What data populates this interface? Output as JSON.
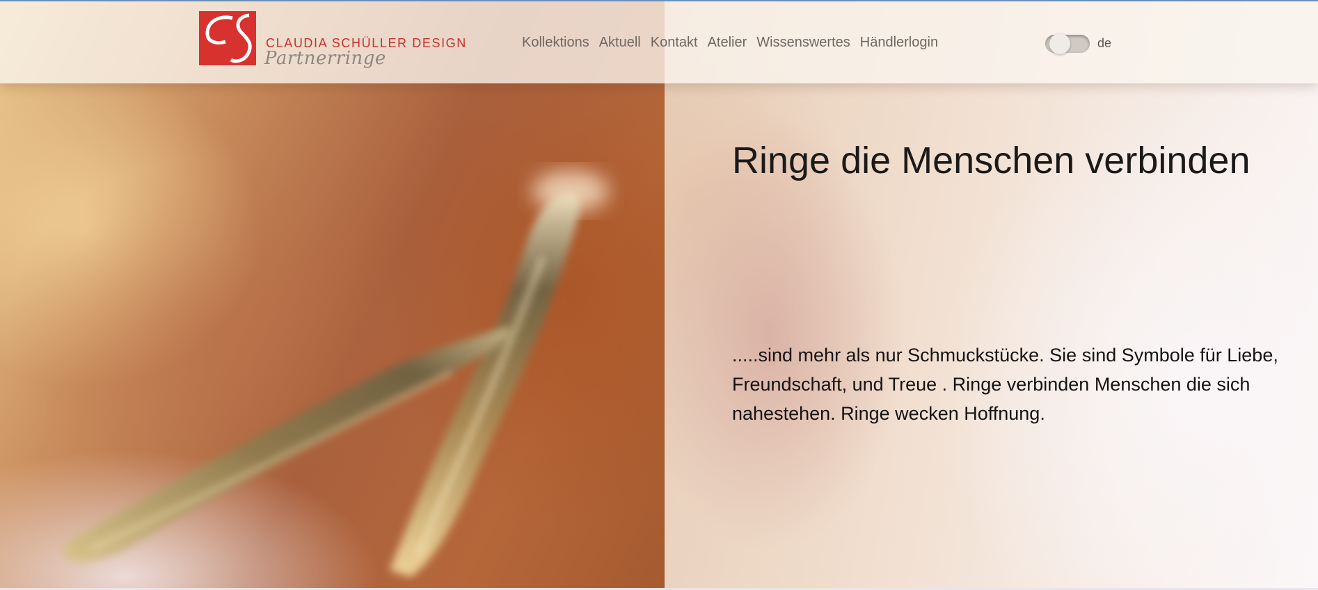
{
  "brand": {
    "company": "CLAUDIA SCHÜLLER DESIGN",
    "tagline": "Partnerringe",
    "logo_color": "#d8322f"
  },
  "nav": {
    "items": [
      {
        "label": "Kollektions"
      },
      {
        "label": "Aktuell"
      },
      {
        "label": "Kontakt"
      },
      {
        "label": "Atelier"
      },
      {
        "label": "Wissenswertes"
      },
      {
        "label": "Händlerlogin"
      }
    ]
  },
  "language": {
    "label": "de"
  },
  "hero": {
    "headline": "Ringe die Menschen verbinden",
    "intro": ".....sind mehr als nur Schmuckstücke. Sie sind Symbole für Liebe, Freundschaft, und Treue . Ringe verbinden Menschen die sich nahestehen. Ringe wecken Hoffnung."
  }
}
